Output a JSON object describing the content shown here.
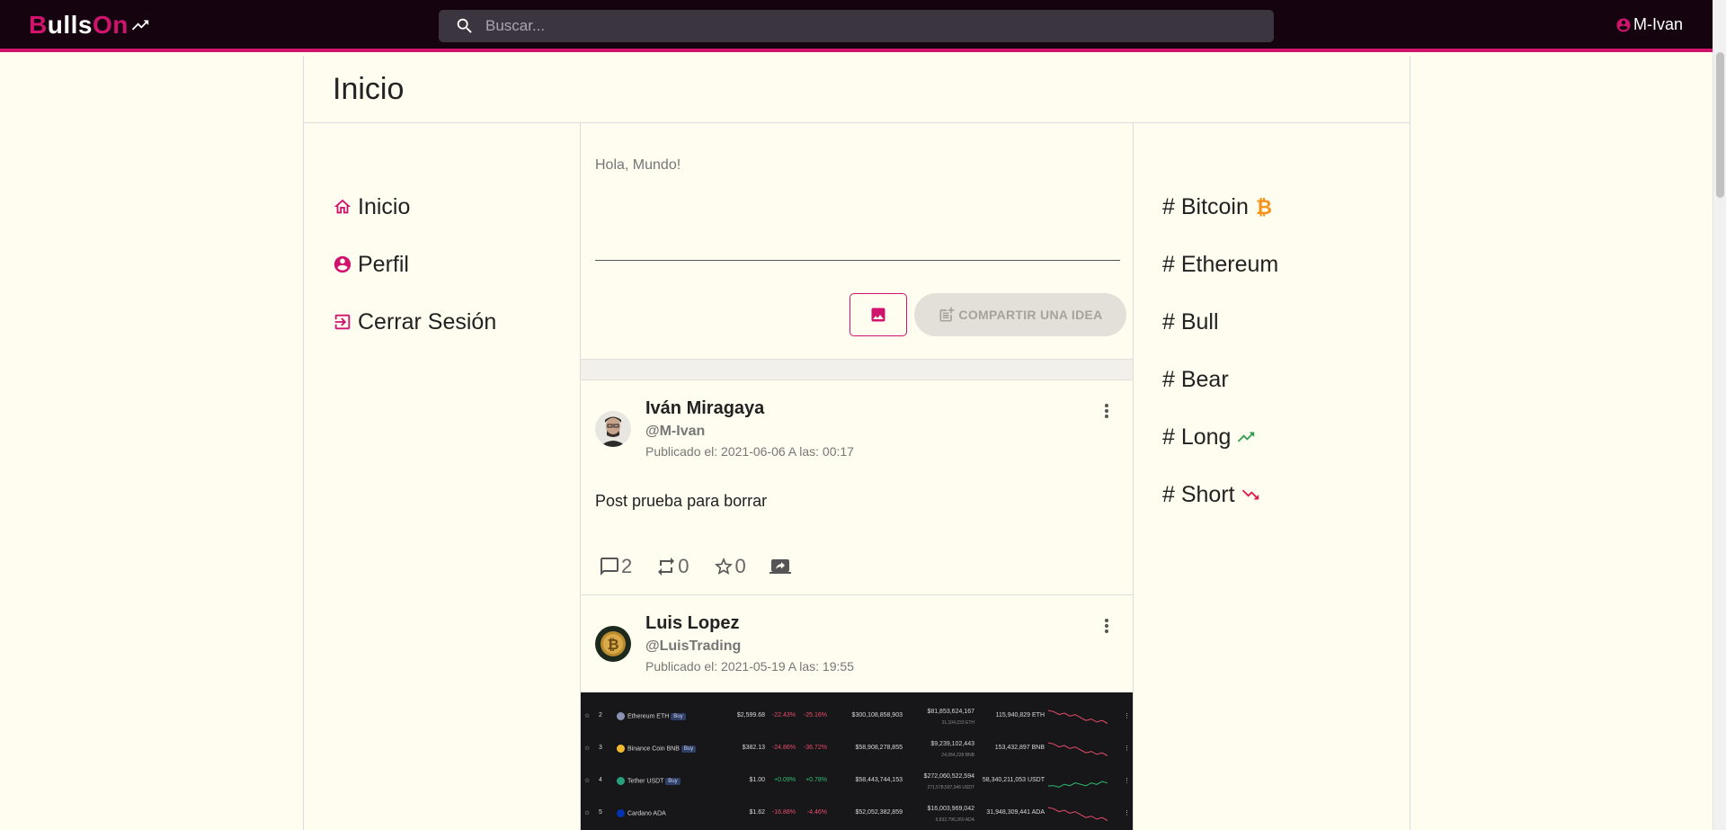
{
  "header": {
    "logo_first": "B",
    "logo_mid": "ulls",
    "logo_end": "On",
    "search_placeholder": "Buscar...",
    "username": "M-Ivan"
  },
  "page": {
    "title": "Inicio"
  },
  "leftnav": {
    "items": [
      {
        "label": "Inicio",
        "icon": "home-icon"
      },
      {
        "label": "Perfil",
        "icon": "account-circle-icon"
      },
      {
        "label": "Cerrar Sesión",
        "icon": "logout-icon"
      }
    ]
  },
  "compose": {
    "placeholder": "Hola, Mundo!",
    "share_label": "COMPARTIR UNA IDEA"
  },
  "posts": [
    {
      "name": "Iván Miragaya",
      "handle": "@M-Ivan",
      "date": "Publicado el: 2021-06-06 A las: 00:17",
      "text": "Post prueba para borrar",
      "comments": "2",
      "retweets": "0",
      "stars": "0"
    },
    {
      "name": "Luis Lopez",
      "handle": "@LuisTrading",
      "date": "Publicado el: 2021-05-19 A las: 19:55"
    }
  ],
  "image_rows": [
    {
      "rank": "2",
      "coin": "Ethereum",
      "sym": "ETH",
      "buy": "Buy",
      "price": "$2,599.68",
      "h24": "-22.43%",
      "d7": "-25.16%",
      "mcap": "$300,108,858,903",
      "vol": "$81,853,624,167",
      "vol_sub": "31,104,233 ETH",
      "supply": "115,940,829 ETH",
      "color": "#8a92b2"
    },
    {
      "rank": "3",
      "coin": "Binance Coin",
      "sym": "BNB",
      "buy": "Buy",
      "price": "$382.13",
      "h24": "-24.86%",
      "d7": "-36.72%",
      "mcap": "$58,908,278,855",
      "vol": "$9,239,102,443",
      "vol_sub": "24,064,228 BNB",
      "supply": "153,432,897 BNB",
      "color": "#f3ba2f"
    },
    {
      "rank": "4",
      "coin": "Tether",
      "sym": "USDT",
      "buy": "Buy",
      "price": "$1.00",
      "h24": "+0.09%",
      "d7": "+0.78%",
      "mcap": "$58,443,744,153",
      "vol": "$272,060,522,594",
      "vol_sub": "271,578,597,346 USDT",
      "supply": "58,340,211,053 USDT",
      "color": "#26a17b"
    },
    {
      "rank": "5",
      "coin": "Cardano",
      "sym": "ADA",
      "buy": "",
      "price": "$1.62",
      "h24": "-16.88%",
      "d7": "-4.46%",
      "mcap": "$52,052,382,859",
      "vol": "$16,003,969,042",
      "vol_sub": "9,832,796,260 ADA",
      "supply": "31,948,309,441 ADA",
      "color": "#0033ad"
    }
  ],
  "rightnav": {
    "tags": [
      {
        "label": "# Bitcoin",
        "icon": "bitcoin-icon"
      },
      {
        "label": "# Ethereum",
        "icon": ""
      },
      {
        "label": "# Bull",
        "icon": ""
      },
      {
        "label": "# Bear",
        "icon": ""
      },
      {
        "label": "# Long",
        "icon": "trending-up-icon"
      },
      {
        "label": "# Short",
        "icon": "trending-down-icon"
      }
    ]
  },
  "colors": {
    "accent": "#d0146e",
    "topbar": "#15040f",
    "background": "#fffdf0",
    "up": "#2e9e4f",
    "down": "#e0194b",
    "bitcoin": "#f7931a"
  }
}
